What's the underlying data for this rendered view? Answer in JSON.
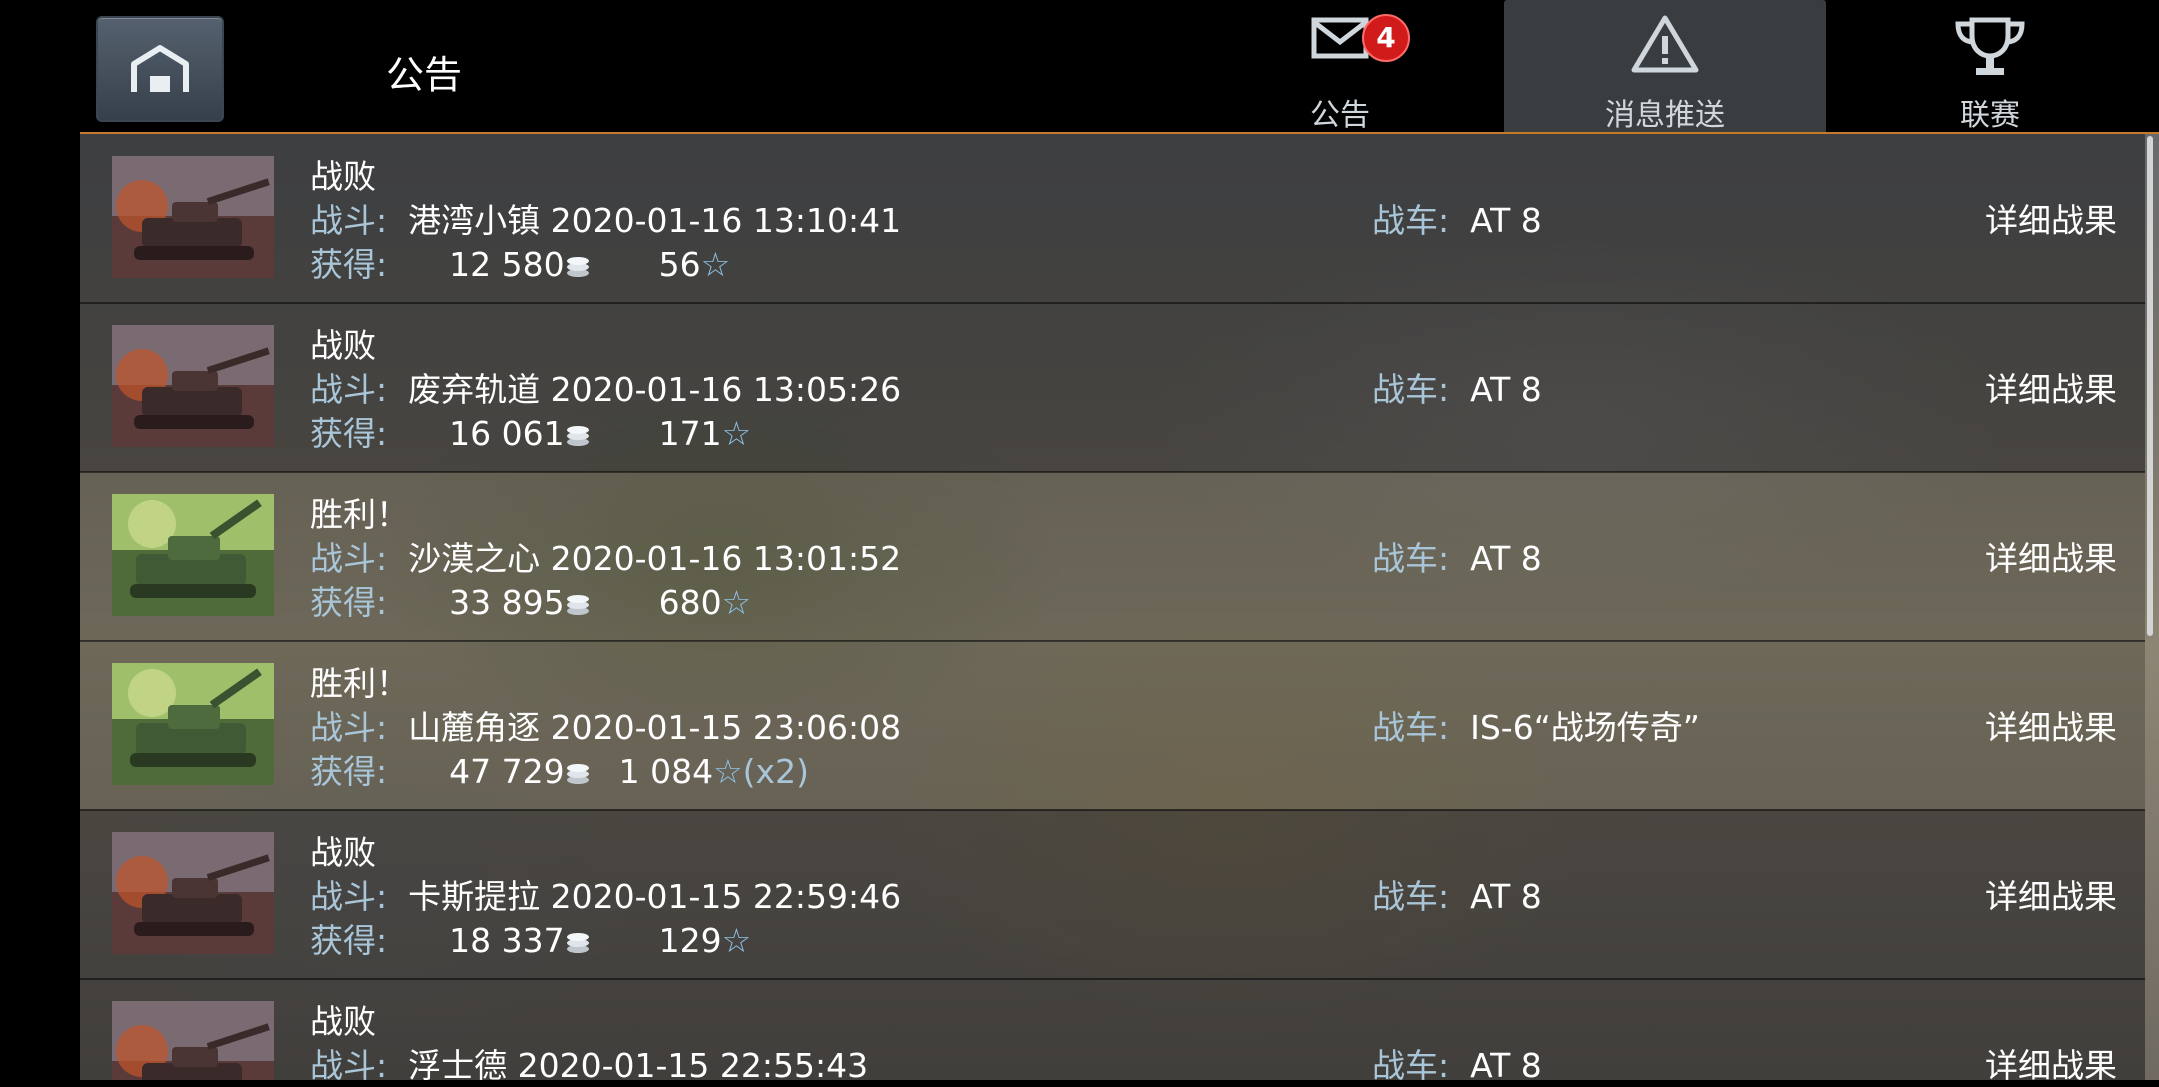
{
  "header": {
    "title": "公告",
    "tabs": [
      {
        "label": "公告",
        "icon": "mail-icon",
        "badge": "4"
      },
      {
        "label": "消息推送",
        "icon": "warning-icon"
      },
      {
        "label": "联赛",
        "icon": "trophy-icon"
      }
    ]
  },
  "labels": {
    "battle": "战斗:",
    "earn": "获得:",
    "tank": "战车:",
    "detail": "详细战果"
  },
  "rows": [
    {
      "result": "战败",
      "map": "港湾小镇",
      "datetime": "2020-01-16 13:10:41",
      "credits": "12 580",
      "xp": "56",
      "multiplier": "",
      "tank": "AT 8",
      "victory": false
    },
    {
      "result": "战败",
      "map": "废弃轨道",
      "datetime": "2020-01-16 13:05:26",
      "credits": "16 061",
      "xp": "171",
      "multiplier": "",
      "tank": "AT 8",
      "victory": false
    },
    {
      "result": "胜利！",
      "map": "沙漠之心",
      "datetime": "2020-01-16 13:01:52",
      "credits": "33 895",
      "xp": "680",
      "multiplier": "",
      "tank": "AT 8",
      "victory": true
    },
    {
      "result": "胜利！",
      "map": "山麓角逐",
      "datetime": "2020-01-15 23:06:08",
      "credits": "47 729",
      "xp": "1 084",
      "multiplier": "(x2)",
      "tank": "IS-6“战场传奇”",
      "victory": true
    },
    {
      "result": "战败",
      "map": "卡斯提拉",
      "datetime": "2020-01-15 22:59:46",
      "credits": "18 337",
      "xp": "129",
      "multiplier": "",
      "tank": "AT 8",
      "victory": false
    },
    {
      "result": "战败",
      "map": "浮士德",
      "datetime": "2020-01-15 22:55:43",
      "credits": "",
      "xp": "",
      "multiplier": "",
      "tank": "AT 8",
      "victory": false
    }
  ],
  "colors": {
    "accent": "#c57a2a",
    "label": "#a9c5d8",
    "badge": "#d11a1a"
  }
}
